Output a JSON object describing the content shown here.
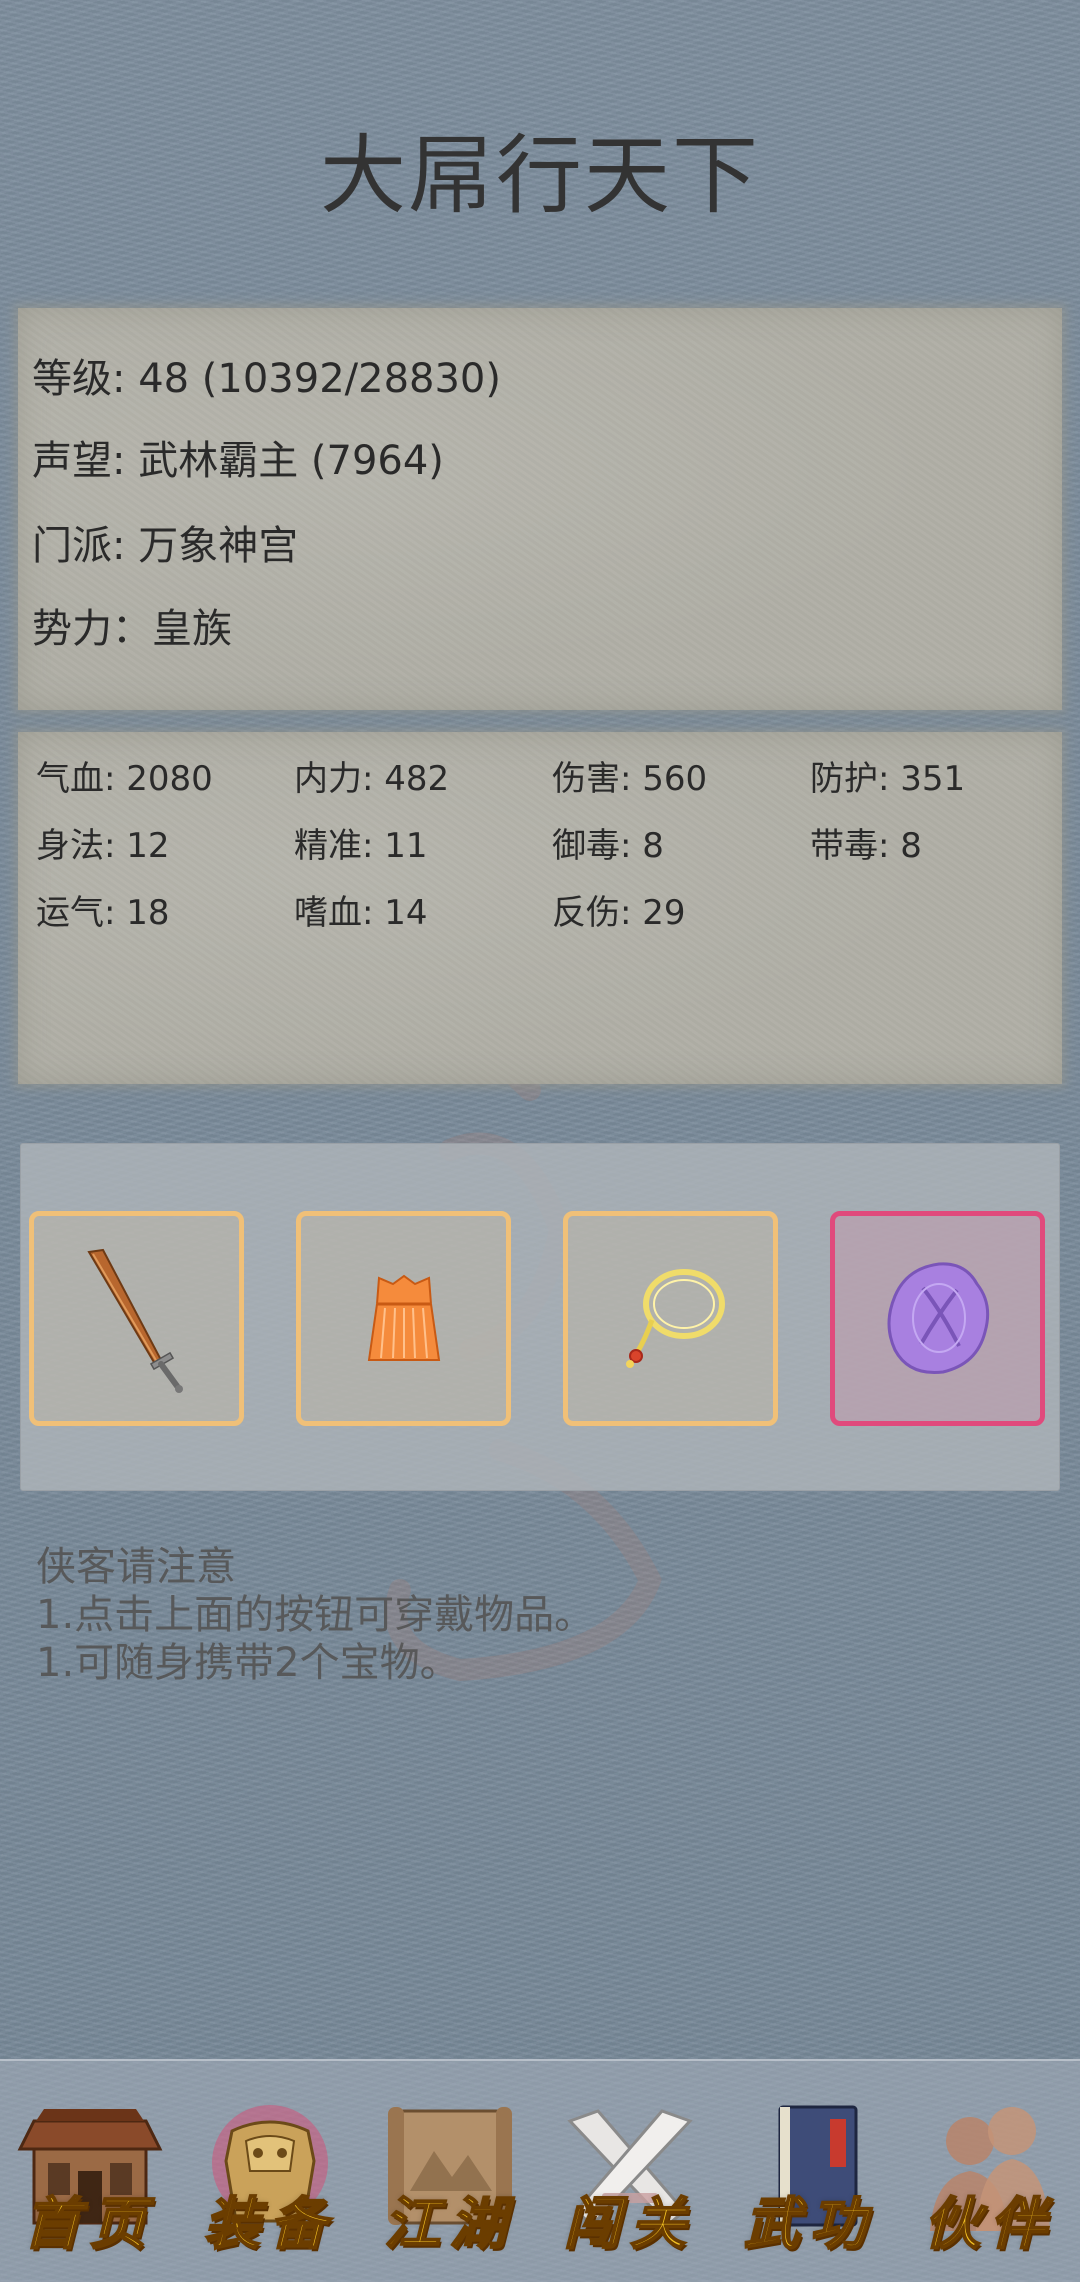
{
  "app": {
    "title": "大屌行天下"
  },
  "profile": {
    "level": "等级: 48 (10392/28830)",
    "reputation": "声望: 武林霸主 (7964)",
    "sect": "门派: 万象神宫",
    "faction": "势力：皇族"
  },
  "stats": [
    "气血: 2080",
    "内力: 482",
    "伤害: 560",
    "防护: 351",
    "身法: 12",
    "精准: 11",
    "御毒: 8",
    "带毒: 8",
    "运气: 18",
    "嗜血: 14",
    "反伤: 29"
  ],
  "equipment": {
    "slots": [
      {
        "icon": "sword-icon",
        "frame_color": "#f0c078"
      },
      {
        "icon": "robe-armor-icon",
        "frame_color": "#f0c078"
      },
      {
        "icon": "necklace-icon",
        "frame_color": "#f0c078"
      },
      {
        "icon": "purple-seal-treasure-icon",
        "frame_color": "#e04a7c"
      }
    ]
  },
  "notice": {
    "heading": "侠客请注意",
    "lines": [
      "1.点击上面的按钮可穿戴物品。",
      "1.可随身携带2个宝物。"
    ]
  },
  "nav": {
    "items": [
      {
        "label": "首页",
        "icon": "house-icon"
      },
      {
        "label": "装备",
        "icon": "armor-icon"
      },
      {
        "label": "江湖",
        "icon": "scroll-map-icon"
      },
      {
        "label": "闯关",
        "icon": "crossed-swords-icon"
      },
      {
        "label": "武功",
        "icon": "book-icon"
      },
      {
        "label": "伙伴",
        "icon": "companions-icon"
      }
    ],
    "active_index": 1
  },
  "colors": {
    "background": "#7c8c9c",
    "paper": "#b0afa6",
    "slot_frame": "#f0c078",
    "slot_frame_rare": "#e04a7c",
    "nav_text": "#f4c223"
  }
}
